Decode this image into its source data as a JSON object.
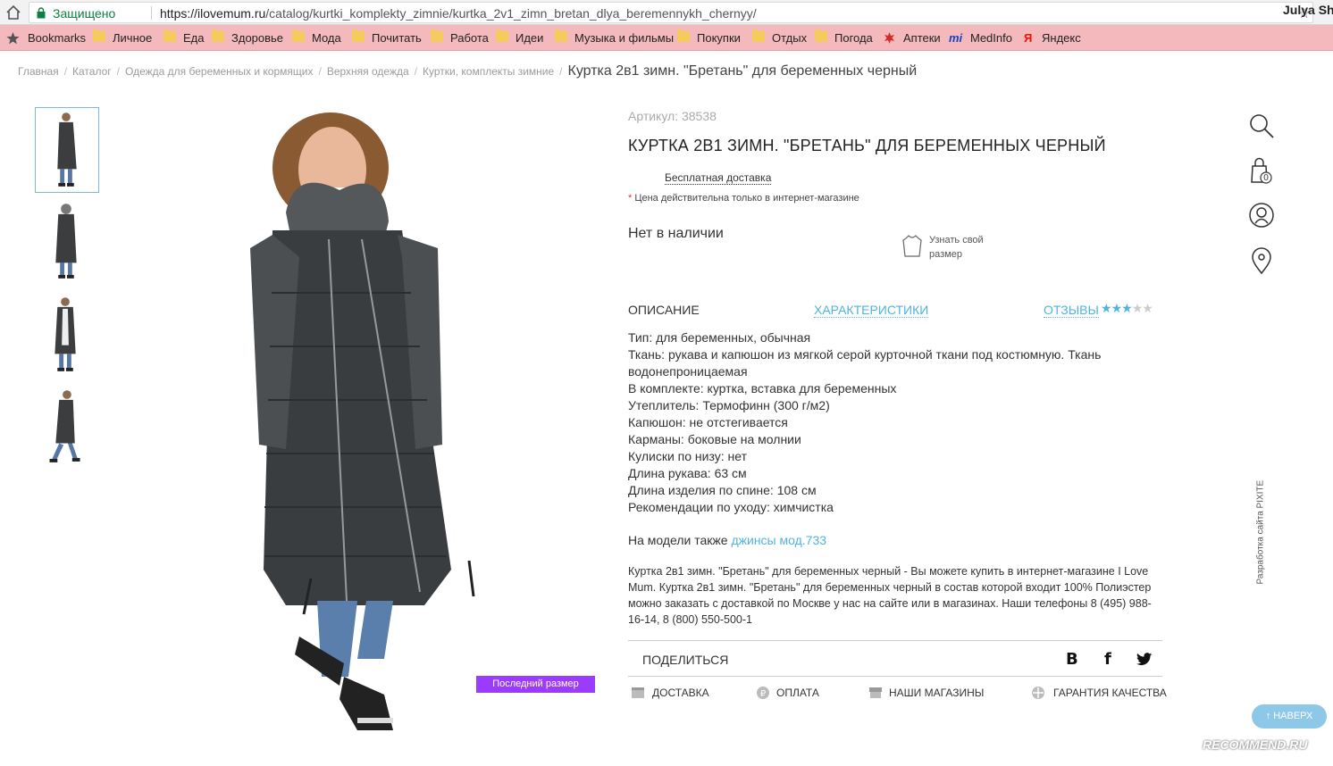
{
  "browser": {
    "secure_label": "Защищено",
    "url_host": "https://ilovemum.ru",
    "url_path": "/catalog/kurtki_komplekty_zimnie/kurtka_2v1_zimn_bretan_dlya_beremennykh_chernyy/",
    "user_name": "Julya Sh",
    "bookmarks": [
      "Bookmarks",
      "Личное",
      "Еда",
      "Здоровье",
      "Мода",
      "Почитать",
      "Работа",
      "Идеи",
      "Музыка и фильмы",
      "Покупки",
      "Отдых",
      "Погода",
      "Аптеки",
      "MedInfo",
      "Яндекс"
    ]
  },
  "breadcrumbs": {
    "items": [
      "Главная",
      "Каталог",
      "Одежда для беременных и кормящих",
      "Верхняя одежда",
      "Куртки, комплекты зимние"
    ],
    "current": "Куртка 2в1 зимн. \"Бретань\" для беременных черный"
  },
  "product": {
    "article": "Артикул: 38538",
    "title": "КУРТКА 2В1 ЗИМН. \"БРЕТАНЬ\" ДЛЯ БЕРЕМЕННЫХ ЧЕРНЫЙ",
    "free_shipping": "Бесплатная доставка",
    "price_note_mark": "*",
    "price_note": " Цена действительна только в интернет-магазине",
    "stock": "Нет в наличии",
    "size_link": "Узнать свой размер",
    "last_size_badge": "Последний размер",
    "rating": 3,
    "rating_max": 5
  },
  "tabs": {
    "description": "ОПИСАНИЕ",
    "characteristics": "ХАРАКТЕРИСТИКИ",
    "reviews": "ОТЗЫВЫ"
  },
  "description_lines": [
    "Тип: для беременных, обычная",
    "Ткань: рукава и капюшон из мягкой серой курточной ткани под костюмную. Ткань водонепроницаемая",
    "В комплекте: куртка, вставка для беременных",
    "Утеплитель: Термофинн (300 г/м2)",
    "Капюшон: не отстегивается",
    "Карманы: боковые на молнии",
    "Кулиски по низу: нет",
    "Длина рукава: 63 см",
    "Длина изделия по спине: 108 см",
    "Рекомендации по уходу: химчистка"
  ],
  "model_note": {
    "prefix": "На модели также ",
    "link": "джинсы мод.733"
  },
  "seo_text": "Куртка 2в1 зимн. \"Бретань\" для беременных черный - Вы можете купить в интернет-магазине I Love Mum. Куртка 2в1 зимн. \"Бретань\" для беременных черный в состав которой входит 100% Полиэстер можно заказать с доставкой по Москве у нас на сайте или в магазинах. Наши телефоны 8 (495) 988-16-14, 8 (800) 550-500-1",
  "share": {
    "label": "ПОДЕЛИТЬСЯ",
    "vk": "В",
    "fb": "f"
  },
  "footer_links": {
    "delivery": "ДОСТАВКА",
    "payment": "ОПЛАТА",
    "stores": "НАШИ МАГАЗИНЫ",
    "quality": "ГАРАНТИЯ КАЧЕСТВА"
  },
  "sidebar": {
    "cart_count": "0",
    "developer": "Разработка сайта PIXITE"
  },
  "up_button": "↑ НАВЕРХ",
  "watermark": "RECOMMEND.RU",
  "colors": {
    "accent_blue": "#4fb3de",
    "badge_purple": "#9b3bff",
    "bookmarks_bar": "#f3b9bd"
  }
}
